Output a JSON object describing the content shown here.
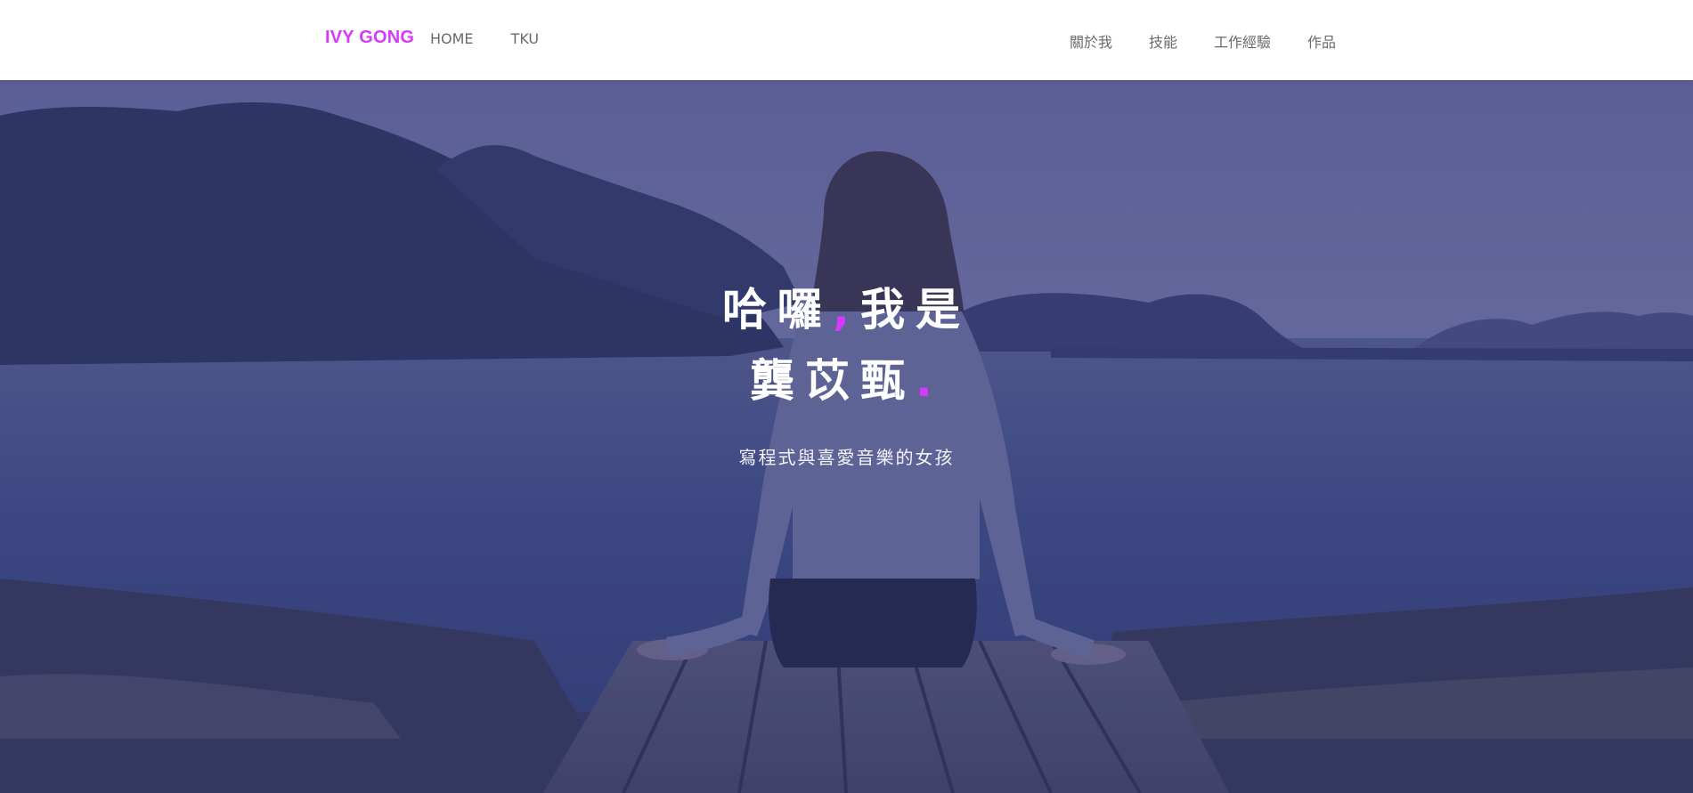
{
  "navbar": {
    "brand": "IVY GONG",
    "left_links": [
      {
        "label": "HOME"
      },
      {
        "label": "TKU"
      }
    ],
    "right_links": [
      {
        "label": "關於我"
      },
      {
        "label": "技能"
      },
      {
        "label": "工作經驗"
      },
      {
        "label": "作品"
      }
    ]
  },
  "hero": {
    "line1_part1": "哈囉",
    "line1_comma": ",",
    "line1_part2": "我是",
    "line2_name": "龔苡甄",
    "line2_dot": ".",
    "subtitle": "寫程式與喜愛音樂的女孩"
  },
  "colors": {
    "accent": "#d63af9",
    "nav_text": "#6a6a6a",
    "hero_overlay": "#2c2e6e"
  }
}
